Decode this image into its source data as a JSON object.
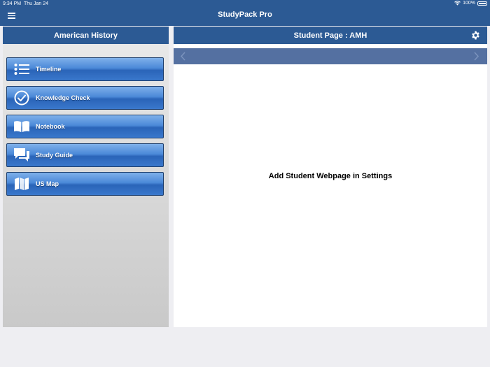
{
  "status_bar": {
    "time": "9:34 PM",
    "date": "Thu Jan 24",
    "battery": "100%"
  },
  "app": {
    "title": "StudyPack Pro"
  },
  "sidebar": {
    "title": "American History",
    "items": [
      {
        "label": "Timeline",
        "icon": "list-icon"
      },
      {
        "label": "Knowledge Check",
        "icon": "checkmark-circle-icon"
      },
      {
        "label": "Notebook",
        "icon": "open-book-icon"
      },
      {
        "label": "Study Guide",
        "icon": "chat-bubbles-icon"
      },
      {
        "label": "US Map",
        "icon": "folded-map-icon"
      }
    ]
  },
  "main": {
    "title": "Student Page : AMH",
    "message": "Add Student Webpage in Settings"
  },
  "colors": {
    "header": "#2c5a94",
    "browser_bar": "#5470a1",
    "button": "#3a78cc"
  }
}
